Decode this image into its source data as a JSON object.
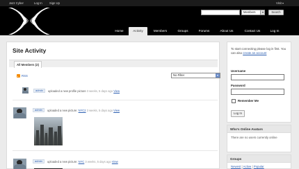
{
  "adminbar": {
    "site_name": "Jazz Cyber",
    "login": "Log In",
    "signup": "Sign Up",
    "visit": "Visit"
  },
  "search": {
    "scope": "Members",
    "button": "Search"
  },
  "nav": [
    "Home",
    "Activity",
    "Members",
    "Groups",
    "Forums",
    "About Us",
    "Contact Us",
    "Log In"
  ],
  "main": {
    "title": "Site Activity",
    "tab_all_members": "All Members (2)",
    "rss": "RSS",
    "filter": "No Filter",
    "activities": [
      {
        "user": "admin",
        "action": "uploaded a new profile picture",
        "link": "",
        "time": "3 weeks, 5 days ago",
        "view": "View"
      },
      {
        "user": "admin",
        "action": "uploaded a new picture:",
        "link": "NYC2",
        "time": "3 weeks, 5 days ago",
        "view": "View"
      },
      {
        "user": "admin",
        "action": "uploaded a new picture:",
        "link": "NYC",
        "time": "3 weeks, 5 days ago",
        "view": "View"
      }
    ]
  },
  "sidebar": {
    "intro_text": "To start connecting please log in first. You can also",
    "intro_link": "create an account",
    "username_label": "Username",
    "password_label": "Password",
    "remember": "Remember Me",
    "login_button": "Log In",
    "online_title": "Who's Online Avatars",
    "online_text": "There are no users currently online",
    "groups_title": "Groups",
    "groups_links": [
      "Newest",
      "Active",
      "Popular"
    ],
    "groups_sep": "|"
  },
  "colors": {
    "header_bg": "#000000",
    "link": "#2a5db0",
    "page_bg": "#ebebeb"
  }
}
